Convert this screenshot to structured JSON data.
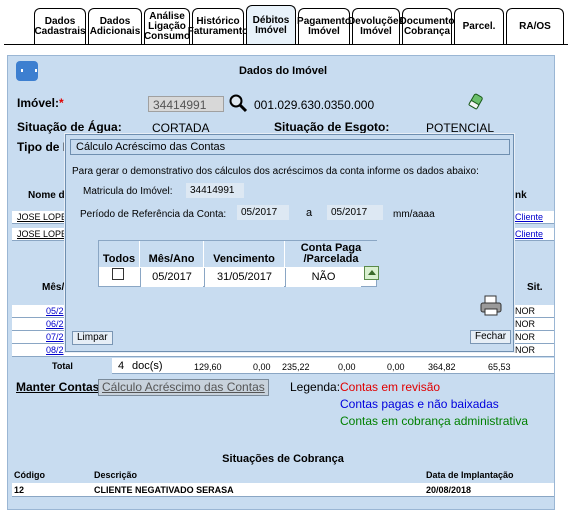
{
  "tabs": [
    {
      "label": "Dados\nCadastrais",
      "active": false
    },
    {
      "label": "Dados\nAdicionais",
      "active": false
    },
    {
      "label": "Análise\nLigação\nConsumo",
      "active": false
    },
    {
      "label": "Histórico\nFaturamento",
      "active": false
    },
    {
      "label": "Débitos\nImóvel",
      "active": true
    },
    {
      "label": "Pagamento\nImóvel",
      "active": false
    },
    {
      "label": "Devoluções\nImóvel",
      "active": false
    },
    {
      "label": "Documento\nCobrança",
      "active": false
    },
    {
      "label": "Parcel.",
      "active": false
    },
    {
      "label": "RA/OS",
      "active": false
    }
  ],
  "imovel": {
    "section_title": "Dados do Imóvel",
    "imovel_label": "Imóvel:",
    "imovel_required": "*",
    "imovel_value": "34414991",
    "inscricao": "001.029.630.0350.000",
    "agua_label": "Situação de Água:",
    "agua_value": "CORTADA",
    "esgoto_label": "Situação de Esgoto:",
    "esgoto_value": "POTENCIAL",
    "tipo_label": "Tipo de L"
  },
  "background": {
    "col_nome": "Nome d",
    "col_link": "nk",
    "clientes": [
      "JOSE LOPE",
      "JOSE LOPE"
    ],
    "cliente_link": "Cliente",
    "col_mes": "Mês/",
    "col_sit": "Sit.",
    "meses": [
      "05/2",
      "06/2",
      "07/2",
      "08/2"
    ],
    "situacoes": [
      "NOR",
      "NOR",
      "NOR",
      "NOR"
    ],
    "total_label": "Total",
    "total_qtd": "4",
    "total_docs": "doc(s)",
    "totais": [
      "129,60",
      "0,00",
      "235,22",
      "0,00",
      "0,00",
      "364,82",
      "65,53"
    ]
  },
  "modal": {
    "title": "Cálculo Acréscimo das Contas",
    "instruction": "Para gerar o demonstrativo dos cálculos dos acréscimos da conta informe os dados  abaixo:",
    "matricula_label": "Matricula do Imóvel:",
    "matricula_value": "34414991",
    "periodo_label": "Período  de Referência da Conta:",
    "periodo_inicio": "05/2017",
    "periodo_sep": "a",
    "periodo_fim": "05/2017",
    "periodo_formato": "mm/aaaa",
    "table_headers": [
      "Todos",
      "Mês/Ano",
      "Vencimento",
      "Conta Paga\n/Parcelada"
    ],
    "row": {
      "mes": "05/2017",
      "vencimento": "31/05/2017",
      "paga": "NÃO"
    },
    "limpar": "Limpar",
    "fechar": "Fechar"
  },
  "actions": {
    "manter_contas": "Manter Contas",
    "calculo_acrescimo": "Cálculo Acréscimo das Contas"
  },
  "legend": {
    "label": "Legenda:",
    "items": [
      {
        "text": "Contas em revisão",
        "color": "#e00000"
      },
      {
        "text": "Contas pagas e não baixadas",
        "color": "#0000dd"
      },
      {
        "text": "Contas em cobrança administrativa",
        "color": "#008000"
      }
    ]
  },
  "cobranca": {
    "title": "Situações de Cobrança",
    "headers": [
      "Código",
      "Descrição",
      "Data de Implantação"
    ],
    "rows": [
      {
        "codigo": "12",
        "descricao": "CLIENTE NEGATIVADO SERASA",
        "data": "20/08/2018"
      }
    ]
  }
}
